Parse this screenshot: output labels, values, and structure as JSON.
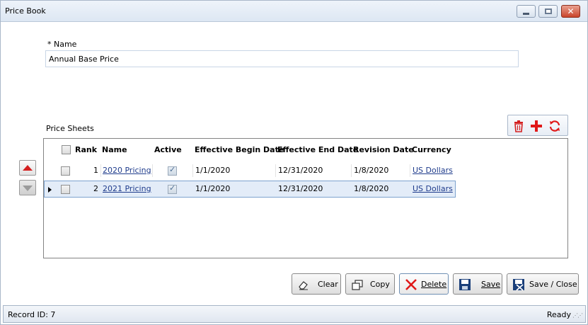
{
  "window": {
    "title": "Price Book"
  },
  "form": {
    "name_label": "* Name",
    "name_value": "Annual Base Price",
    "price_sheets_label": "Price Sheets"
  },
  "grid": {
    "columns": {
      "rank": "Rank",
      "name": "Name",
      "active": "Active",
      "begin": "Effective Begin Date",
      "end": "Effective End Date",
      "revision": "Revision Date",
      "currency": "Currency"
    },
    "rows": [
      {
        "rank": "1",
        "name": "2020 Pricing",
        "active": true,
        "begin": "1/1/2020",
        "end": "12/31/2020",
        "revision": "1/8/2020",
        "currency": "US Dollars"
      },
      {
        "rank": "2",
        "name": "2021 Pricing",
        "active": true,
        "begin": "1/1/2020",
        "end": "12/31/2020",
        "revision": "1/8/2020",
        "currency": "US Dollars",
        "selected": true
      }
    ]
  },
  "toolbar": {
    "icons": [
      "trash-icon",
      "plus-icon",
      "refresh-icon"
    ]
  },
  "actions": {
    "clear": "Clear",
    "copy": "Copy",
    "delete": "Delete",
    "save": "Save",
    "save_close": "Save / Close"
  },
  "status": {
    "record": "Record ID: 7",
    "state": "Ready"
  },
  "colors": {
    "accent_red": "#d42020",
    "link": "#1f3c8c",
    "selected_row": "#e3ecf8"
  }
}
